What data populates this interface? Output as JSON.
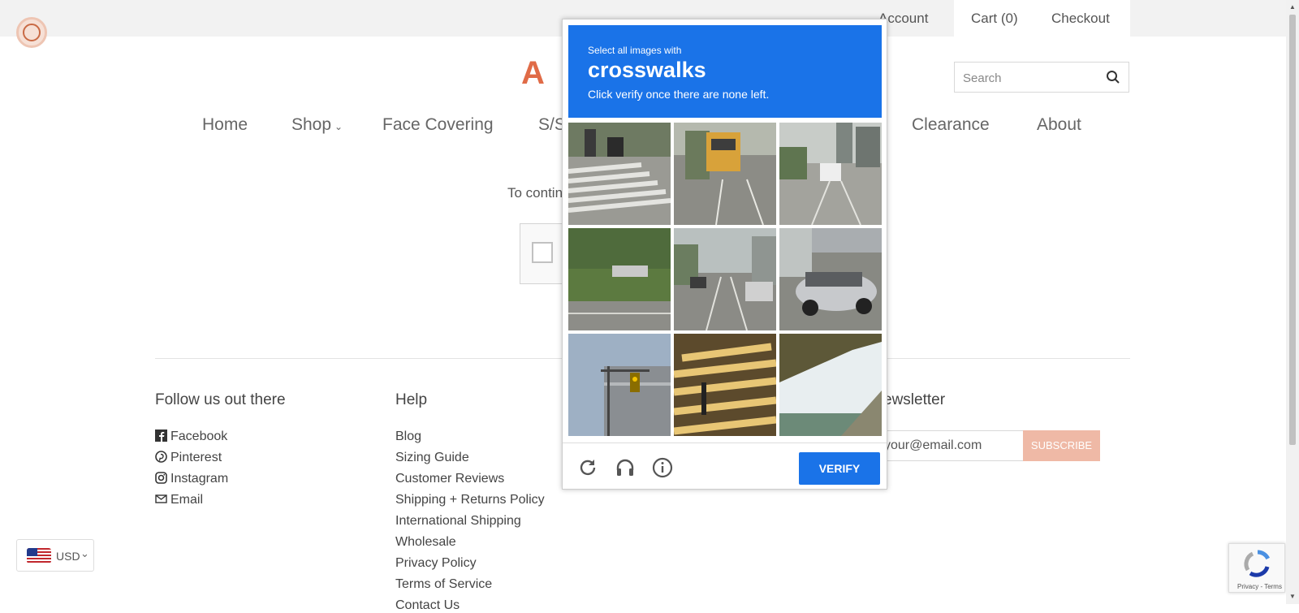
{
  "header": {
    "links": {
      "account": "Account",
      "cart": "Cart (0)",
      "checkout": "Checkout"
    },
    "logo_text": "A L",
    "search_placeholder": "Search"
  },
  "nav": {
    "items": [
      "Home",
      "Shop",
      "Face Covering",
      "S/S",
      "Clearance",
      "About"
    ]
  },
  "main": {
    "hint_text": "To contin"
  },
  "captcha_challenge": {
    "instruction_small": "Select all images with",
    "target": "crosswalks",
    "instruction_sub": "Click verify once there are none left.",
    "tiles": [
      "crosswalk-street-scene",
      "school-bus-road",
      "city-bus-road",
      "grass-roadside",
      "busy-street",
      "parked-silver-car",
      "traffic-light-building",
      "crosswalk-stripes",
      "window-view"
    ],
    "verify_label": "VERIFY",
    "icons": [
      "reload-icon",
      "audio-icon",
      "info-icon"
    ],
    "accent_color": "#1a73e8"
  },
  "footer": {
    "follow": {
      "heading": "Follow us out there",
      "links": [
        "Facebook",
        "Pinterest",
        "Instagram",
        "Email"
      ]
    },
    "help": {
      "heading": "Help",
      "links": [
        "Blog",
        "Sizing Guide",
        "Customer Reviews",
        "Shipping + Returns Policy",
        "International Shipping",
        "Wholesale",
        "Privacy Policy",
        "Terms of Service",
        "Contact Us"
      ]
    },
    "newsletter": {
      "heading": "ewsletter",
      "email_value": "your@email.com",
      "subscribe_label": "SUBSCRIBE"
    }
  },
  "currency": {
    "code": "USD"
  },
  "recaptcha_badge": {
    "text": "Privacy - Terms"
  }
}
